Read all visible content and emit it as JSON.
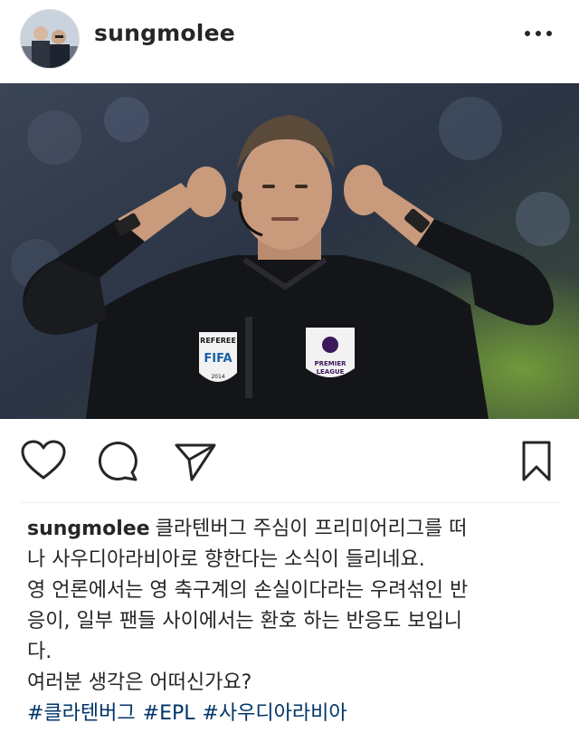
{
  "post": {
    "username": "sungmolee",
    "photo_badges": {
      "referee": "REFEREE",
      "fifa": "FIFA",
      "year": "2014",
      "league_line1": "PREMIER",
      "league_line2": "LEAGUE"
    },
    "caption": {
      "username": "sungmolee",
      "text_line1": "클라텐버그 주심이 프리미어리그를 떠",
      "text_line2": "나 사우디아라비아로 향한다는 소식이 들리네요.",
      "text_line3": "영 언론에서는 영 축구계의 손실이다라는 우려섞인 반",
      "text_line4": "응이, 일부 팬들 사이에서는 환호 하는 반응도 보입니",
      "text_line5": "다.",
      "text_line6": "여러분 생각은 어떠신가요?",
      "hashtags": [
        "#클라텐버그",
        "#EPL",
        "#사우디아라비아"
      ]
    }
  },
  "icons": {
    "more": "more-options-icon",
    "like": "heart-icon",
    "comment": "comment-icon",
    "share": "send-icon",
    "save": "bookmark-icon"
  },
  "colors": {
    "text": "#262626",
    "hashtag": "#003569",
    "divider": "#efefef"
  }
}
